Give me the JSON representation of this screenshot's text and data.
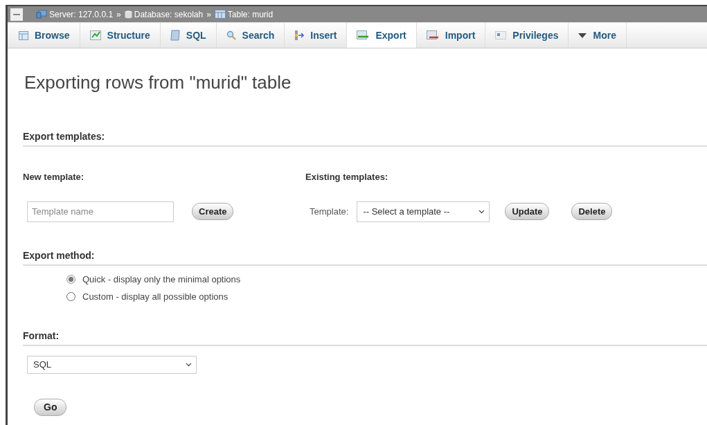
{
  "breadcrumb": [
    {
      "kind": "server",
      "label": "Server: 127.0.0.1"
    },
    {
      "kind": "database",
      "label": "Database: sekolah"
    },
    {
      "kind": "table",
      "label": "Table: murid"
    }
  ],
  "breadcrumb_separator": "»",
  "tabs": [
    {
      "kind": "browse",
      "label": "Browse",
      "selected": false
    },
    {
      "kind": "structure",
      "label": "Structure",
      "selected": false
    },
    {
      "kind": "sql",
      "label": "SQL",
      "selected": false
    },
    {
      "kind": "search",
      "label": "Search",
      "selected": false
    },
    {
      "kind": "insert",
      "label": "Insert",
      "selected": false
    },
    {
      "kind": "export",
      "label": "Export",
      "selected": true
    },
    {
      "kind": "import",
      "label": "Import",
      "selected": false
    },
    {
      "kind": "privileges",
      "label": "Privileges",
      "selected": false
    },
    {
      "kind": "more",
      "label": "More",
      "selected": false
    }
  ],
  "title": "Exporting rows from \"murid\" table",
  "export_templates": {
    "heading": "Export templates:",
    "new_heading": "New template:",
    "name_field": {
      "placeholder": "Template name"
    },
    "create_button": "Create",
    "existing_heading": "Existing templates:",
    "template_label": "Template:",
    "template_select": "-- Select a template --",
    "update_button": "Update",
    "delete_button": "Delete"
  },
  "export_method": {
    "heading": "Export method:",
    "options": [
      {
        "label": "Quick - display only the minimal options",
        "selected": true
      },
      {
        "label": "Custom - display all possible options",
        "selected": false
      }
    ]
  },
  "format": {
    "heading": "Format:",
    "value": "SQL"
  },
  "go_button": "Go"
}
